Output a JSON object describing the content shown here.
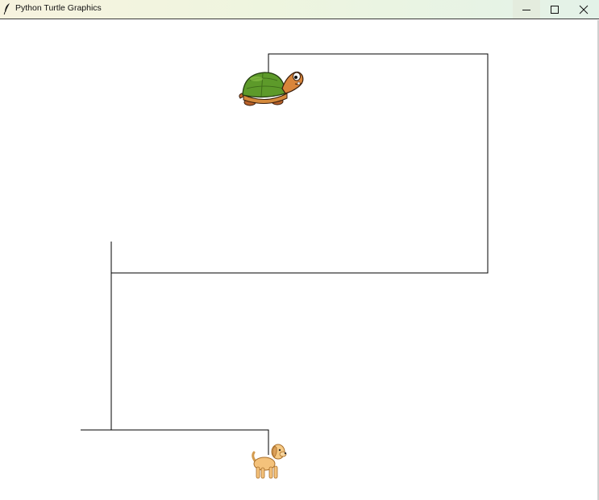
{
  "window": {
    "title": "Python Turtle Graphics",
    "icon": "feather-icon",
    "controls": [
      {
        "name": "minimize",
        "icon": "minimize-icon"
      },
      {
        "name": "maximize",
        "icon": "maximize-icon"
      },
      {
        "name": "close",
        "icon": "close-icon"
      }
    ]
  },
  "canvas": {
    "background": "#ffffff",
    "pen_color": "#000000",
    "sprites": [
      {
        "name": "turtle",
        "icon": "turtle-icon"
      },
      {
        "name": "dog",
        "icon": "dog-icon"
      }
    ]
  }
}
